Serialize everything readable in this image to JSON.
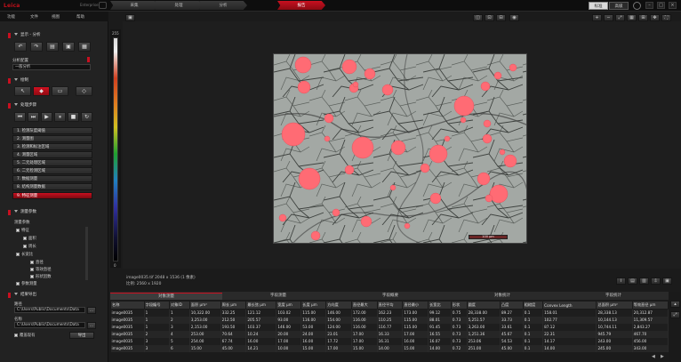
{
  "app": {
    "logo": "Leica",
    "subtitle": "Enterprise"
  },
  "workflow": [
    "采集",
    "处理",
    "分析",
    "报告"
  ],
  "mode": {
    "standard": "标准",
    "advanced": "高级"
  },
  "menu": [
    "功能",
    "文件",
    "视图",
    "帮助"
  ],
  "left": {
    "section1": "显示 - 分析",
    "config_label": "分析配置",
    "config_value": "一般分析",
    "section2": "绘制",
    "section3": "处理步骤",
    "steps": [
      "1. 检测灰度阈值",
      "2. 测量图",
      "3. 检测和标注区域",
      "4. 测量区域",
      "5. 二元处理区域",
      "6. 二元检测区域",
      "7. 数据测量",
      "8. 结构测量数据",
      "9. 特征测量"
    ],
    "active_step": 8,
    "section4": "测量参数",
    "tree_title": "测量参数",
    "tree": [
      "特征",
      "面积",
      "周长",
      "长宽比",
      "直径",
      "等效直径",
      "形状因数",
      "参数测量"
    ],
    "section5": "结果导出",
    "path_label": "路径",
    "path1": "C:\\Users\\Public\\Documents\\Data",
    "name_label": "名称",
    "path2": "C:\\Users\\Public\\Documents\\Data",
    "overwrite_label": "覆盖现有",
    "export_btn": "导出"
  },
  "colorbar": {
    "top": "255",
    "bottom": "0"
  },
  "viewer": {
    "scale_label": "100 μm",
    "info1": "image0035.tif 2048 x 1536 (1 像素)",
    "info2": "比例: 2560 x 1920"
  },
  "tabs": [
    "对象测量",
    "字段测量",
    "字段概要",
    "对象统计",
    "字段统计"
  ],
  "table": {
    "headers": [
      "名称",
      "字段编号",
      "对象ID",
      "面积 μm²",
      "周长 μm",
      "最长弦 μm",
      "宽度 μm",
      "长度 μm",
      "方向度",
      "直径最大",
      "直径平均",
      "直径最小",
      "长宽比",
      "形状",
      "圆度",
      "凸度",
      "粗糙度",
      "Convex Length",
      "总面积 μm²",
      "等效直径 μm"
    ],
    "rows": [
      [
        "image0035",
        "1",
        "1",
        "10,322.00",
        "332.25",
        "121.12",
        "103.02",
        "115.00",
        "146.00",
        "172.00",
        "162.23",
        "173.00",
        "99.12",
        "0.75",
        "28,338.00",
        "89.27",
        "0.1",
        "158.01",
        "28,338.13",
        "20,312.87"
      ],
      [
        "image0035",
        "1",
        "2",
        "3,253.00",
        "212.50",
        "205.57",
        "93.00",
        "116.00",
        "154.00",
        "116.00",
        "110.25",
        "115.00",
        "88.01",
        "0.73",
        "5,251.57",
        "33.73",
        "0.1",
        "102.77",
        "10,144.13",
        "11,309.57"
      ],
      [
        "image0035",
        "1",
        "3",
        "2,153.00",
        "193.50",
        "103.37",
        "146.00",
        "53.00",
        "124.00",
        "116.00",
        "116.77",
        "115.00",
        "91.45",
        "0.73",
        "3,263.00",
        "33.61",
        "0.1",
        "87.12",
        "10,744.11",
        "2,843.27"
      ],
      [
        "image0035",
        "2",
        "4",
        "253.00",
        "70.64",
        "10.24",
        "20.00",
        "24.00",
        "23.01",
        "17.00",
        "16.33",
        "17.00",
        "16.55",
        "0.73",
        "1,251.36",
        "45.67",
        "0.1",
        "22.31",
        "945.79",
        "467.70"
      ],
      [
        "image0035",
        "3",
        "5",
        "254.00",
        "67.74",
        "16.00",
        "17.00",
        "16.00",
        "17.72",
        "17.00",
        "16.31",
        "16.00",
        "16.07",
        "0.73",
        "253.06",
        "54.53",
        "0.1",
        "14.17",
        "243.00",
        "456.00"
      ],
      [
        "image0035",
        "3",
        "6",
        "15.00",
        "45.00",
        "14.21",
        "10.00",
        "15.00",
        "17.00",
        "15.00",
        "14.00",
        "15.00",
        "14.00",
        "0.72",
        "251.00",
        "45.00",
        "0.1",
        "14.00",
        "245.00",
        "343.00"
      ]
    ]
  },
  "colors": {
    "accent": "#c81020",
    "particles": "#ff6b74",
    "background": "#1b1b1b"
  }
}
